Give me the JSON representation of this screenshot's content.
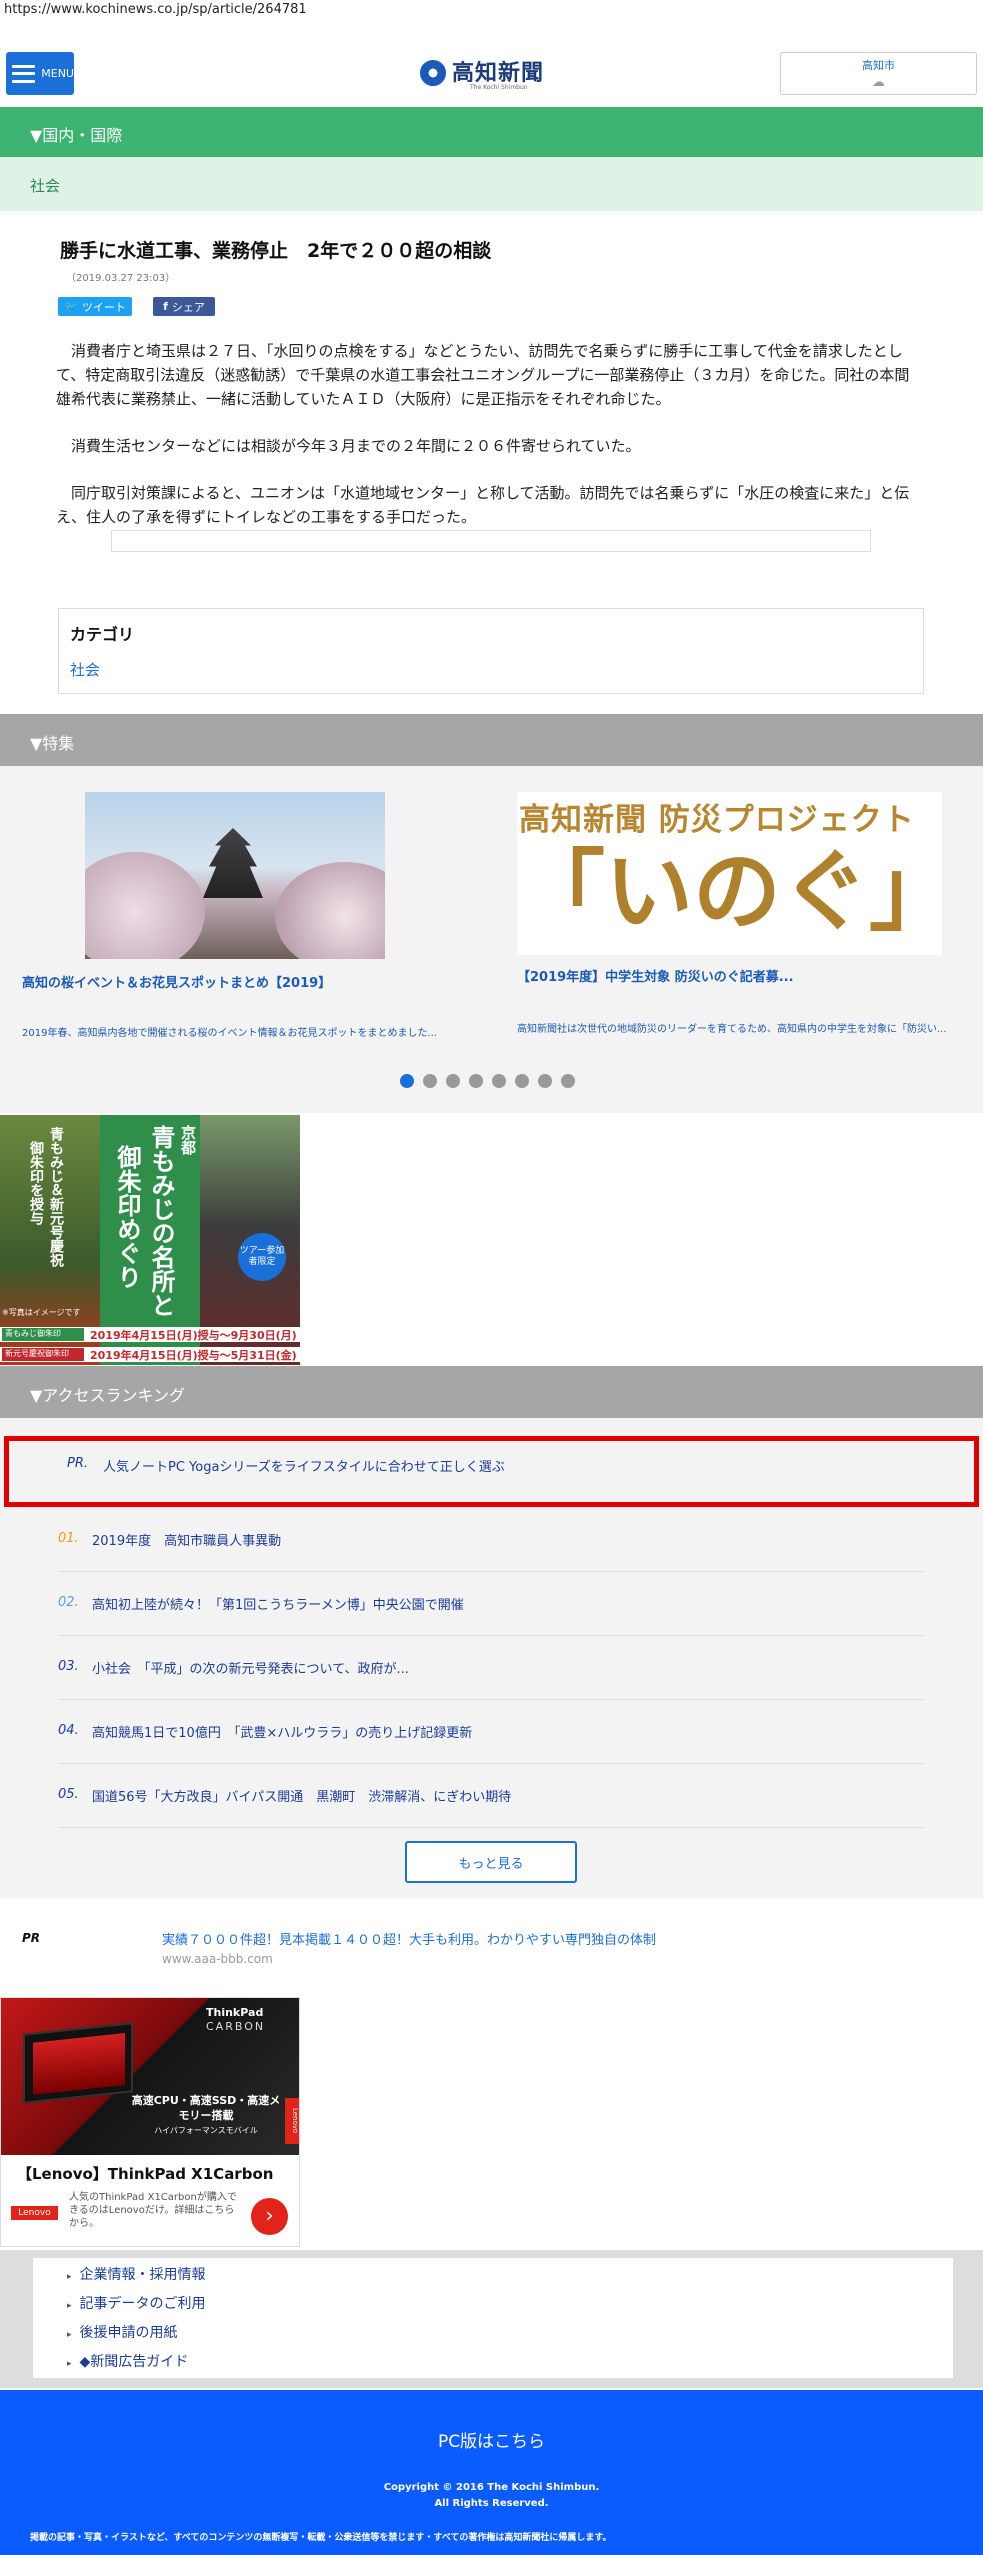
{
  "browser": {
    "url": "https://www.kochinews.co.jp/sp/article/264781"
  },
  "header": {
    "menu_label": "MENU",
    "logo_name": "高知新聞",
    "logo_sub": "The Kochi Shimbun",
    "weather_city": "高知市",
    "weather_icon": "cloud-icon"
  },
  "category": {
    "section": "▼国内・国際",
    "sub": "社会"
  },
  "article": {
    "title": "勝手に水道工事、業務停止　2年で２００超の相談",
    "date": "（2019.03.27 23:03）",
    "tweet_label": "ツイート",
    "share_label": "シェア",
    "paragraphs": [
      "消費者庁と埼玉県は２７日、「水回りの点検をする」などとうたい、訪問先で名乗らずに勝手に工事して代金を請求したとして、特定商取引法違反（迷惑勧誘）で千葉県の水道工事会社ユニオングループに一部業務停止（３カ月）を命じた。同社の本間雄希代表に業務禁止、一緒に活動していたＡＩＤ（大阪府）に是正指示をそれぞれ命じた。",
      "消費生活センターなどには相談が今年３月までの２年間に２０６件寄せられていた。",
      "同庁取引対策課によると、ユニオンは「水道地域センター」と称して活動。訪問先では名乗らずに「水圧の検査に来た」と伝え、住人の了承を得ずにトイレなどの工事をする手口だった。"
    ]
  },
  "category_box": {
    "heading": "カテゴリ",
    "link": "社会"
  },
  "features": {
    "heading": "▼特集",
    "items": [
      {
        "caption": "高知の桜イベント＆お花見スポットまとめ【2019】",
        "desc": "2019年春、高知県内各地で開催される桜のイベント情報＆お花見スポットをまとめました..."
      },
      {
        "image_title": "高知新聞 防災プロジェクト",
        "image_big": "「いのぐ」",
        "caption": "【2019年度】中学生対象 防災いのぐ記者募...",
        "desc": "高知新聞社は次世代の地域防災のリーダーを育てるため、高知県内の中学生を対象に「防災い..."
      }
    ],
    "dots": 8,
    "active_dot": 0
  },
  "ad_kyoto": {
    "line_left": "青もみじ＆新元号慶祝",
    "line_left2": "御朱印を授与",
    "kyoto": "京都",
    "main1": "青もみじの名所と",
    "main2": "御朱印めぐり",
    "badge": "ツアー参加者限定",
    "note": "※写真はイメージです",
    "tag1": "青もみじ御朱印",
    "tag2": "新元号慶祝御朱印",
    "date1": "2019年4月15日(月)授与～9月30日(月)授与",
    "date2": "2019年4月15日(月)授与～5月31日(金)授与"
  },
  "ranking": {
    "heading": "▼アクセスランキング",
    "pr_label": "PR.",
    "pr_text": "人気ノートPC Yogaシリーズをライフスタイルに合わせて正しく選ぶ",
    "items": [
      {
        "no": "01.",
        "text": "2019年度　高知市職員人事異動"
      },
      {
        "no": "02.",
        "text": "高知初上陸が続々！「第1回こうちラーメン博」中央公園で開催"
      },
      {
        "no": "03.",
        "text": "小社会　「平成」の次の新元号発表について、政府が..."
      },
      {
        "no": "04.",
        "text": "高知競馬1日で10億円　「武豊×ハルウララ」の売り上げ記録更新"
      },
      {
        "no": "05.",
        "text": "国道56号「大方改良」バイパス開通　黒潮町　渋滞解消、にぎわい期待"
      }
    ],
    "more": "もっと見る",
    "rank_colors": [
      "#e8a000",
      "#5aa0e0",
      "#1a3c9a",
      "#1a3c9a",
      "#1a3c9a"
    ]
  },
  "pr_text_ad": {
    "label": "PR",
    "link": "実績７０００件超！見本掲載１４００超！大手も利用。わかりやすい専門独自の体制",
    "url": "www.aaa-bbb.com"
  },
  "ad_lenovo": {
    "brand": "ThinkPad",
    "brand_sub": "CARBON",
    "spec": "高速CPU・高速SSD・高速メモリー搭載",
    "spec_small": "ハイパフォーマンスモバイル",
    "side": "Lenovo",
    "name": "【Lenovo】ThinkPad X1Carbon",
    "logo": "Lenovo",
    "desc": "人気のThinkPad X1Carbonが購入できるのはLenovoだけ。詳細はこちらから。",
    "arrow": "›"
  },
  "footer": {
    "links": [
      "企業情報・採用情報",
      "記事データのご利用",
      "後援申請の用紙",
      "◆新聞広告ガイド"
    ],
    "pc": "PC版はこちら",
    "copyright1": "Copyright © 2016 The Kochi Shimbun.",
    "copyright2": "All Rights Reserved.",
    "note": "掲載の記事・写真・イラストなど、すべてのコンテンツの無断複写・転載・公衆送信等を禁じます・すべての著作権は高知新聞社に帰属します。"
  }
}
